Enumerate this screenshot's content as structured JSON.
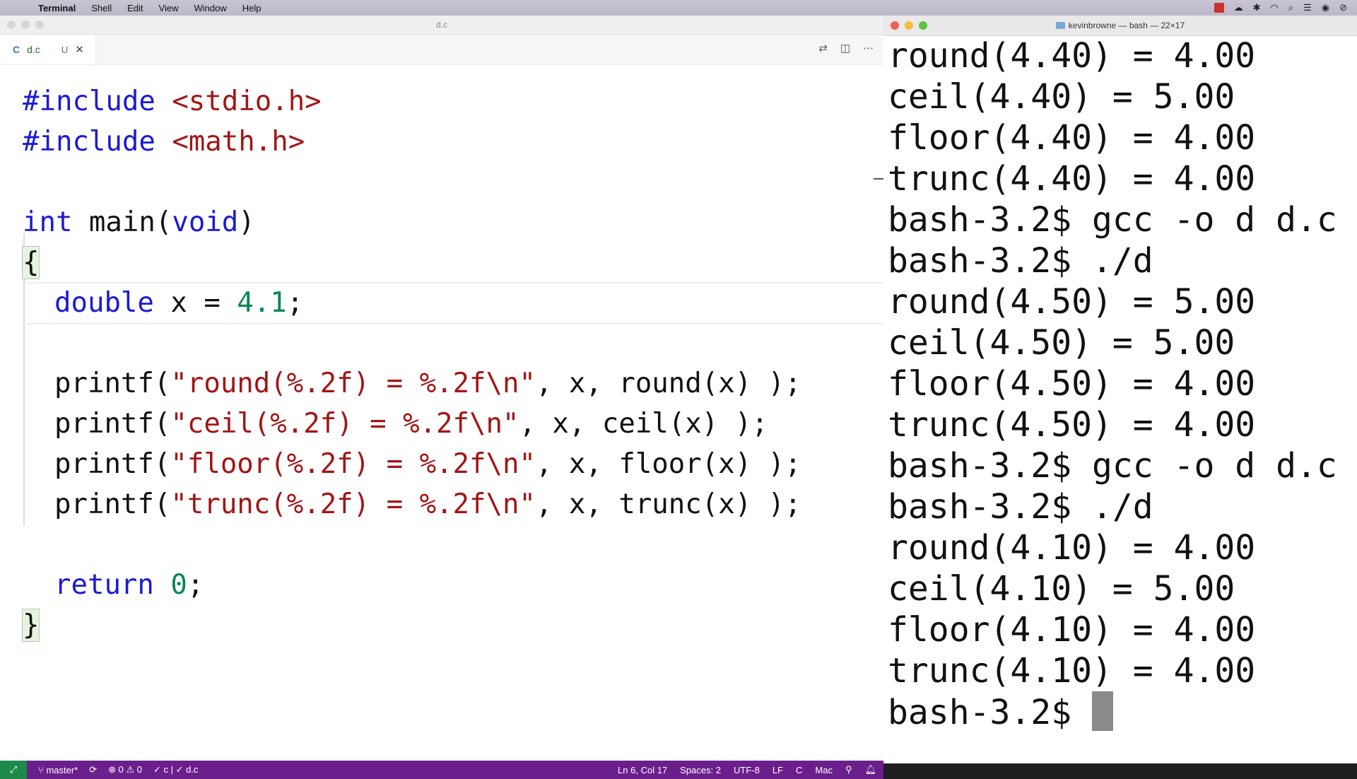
{
  "menubar": {
    "items": [
      "Terminal",
      "Shell",
      "Edit",
      "View",
      "Window",
      "Help"
    ]
  },
  "editor": {
    "window_title": "d.c",
    "tab": {
      "icon_letter": "C",
      "label": "d.c",
      "status": "U"
    },
    "code": {
      "include1_directive": "#include",
      "include1_header": "<stdio.h>",
      "include2_directive": "#include",
      "include2_header": "<math.h>",
      "main_type": "int",
      "main_name": " main(",
      "main_param": "void",
      "main_close": ")",
      "open_brace": "{",
      "decl_type": "double",
      "decl_rest": " x = ",
      "decl_value": "4.1",
      "decl_end": ";",
      "printf_round_fn": "printf(",
      "printf_round_str": "\"round(%.2f) = %.2f\\n\"",
      "printf_round_args": ", x, round(x) );",
      "printf_ceil_fn": "printf(",
      "printf_ceil_str": "\"ceil(%.2f) = %.2f\\n\"",
      "printf_ceil_args": ", x, ceil(x) );",
      "printf_floor_fn": "printf(",
      "printf_floor_str": "\"floor(%.2f) = %.2f\\n\"",
      "printf_floor_args": ", x, floor(x) );",
      "printf_trunc_fn": "printf(",
      "printf_trunc_str": "\"trunc(%.2f) = %.2f\\n\"",
      "printf_trunc_args": ", x, trunc(x) );",
      "return_kw": "return",
      "return_value": "0",
      "return_end": ";",
      "close_brace": "}"
    }
  },
  "statusbar": {
    "branch": "master*",
    "problems": "⊗ 0 ⚠ 0",
    "checks": "✓ c | ✓ d.c",
    "position": "Ln 6, Col 17",
    "spaces": "Spaces: 2",
    "encoding": "UTF-8",
    "eol": "LF",
    "language": "C",
    "platform": "Mac"
  },
  "terminal": {
    "title": "kevinbrowne — bash — 22×17",
    "lines": [
      "round(4.40) = 4.00",
      "ceil(4.40) = 5.00",
      "floor(4.40) = 4.00",
      "trunc(4.40) = 4.00",
      "bash-3.2$ gcc -o d d.c",
      "bash-3.2$ ./d",
      "round(4.50) = 5.00",
      "ceil(4.50) = 5.00",
      "floor(4.50) = 4.00",
      "trunc(4.50) = 4.00",
      "bash-3.2$ gcc -o d d.c",
      "bash-3.2$ ./d",
      "round(4.10) = 4.00",
      "ceil(4.10) = 5.00",
      "floor(4.10) = 4.00",
      "trunc(4.10) = 4.00",
      "bash-3.2$ "
    ]
  }
}
